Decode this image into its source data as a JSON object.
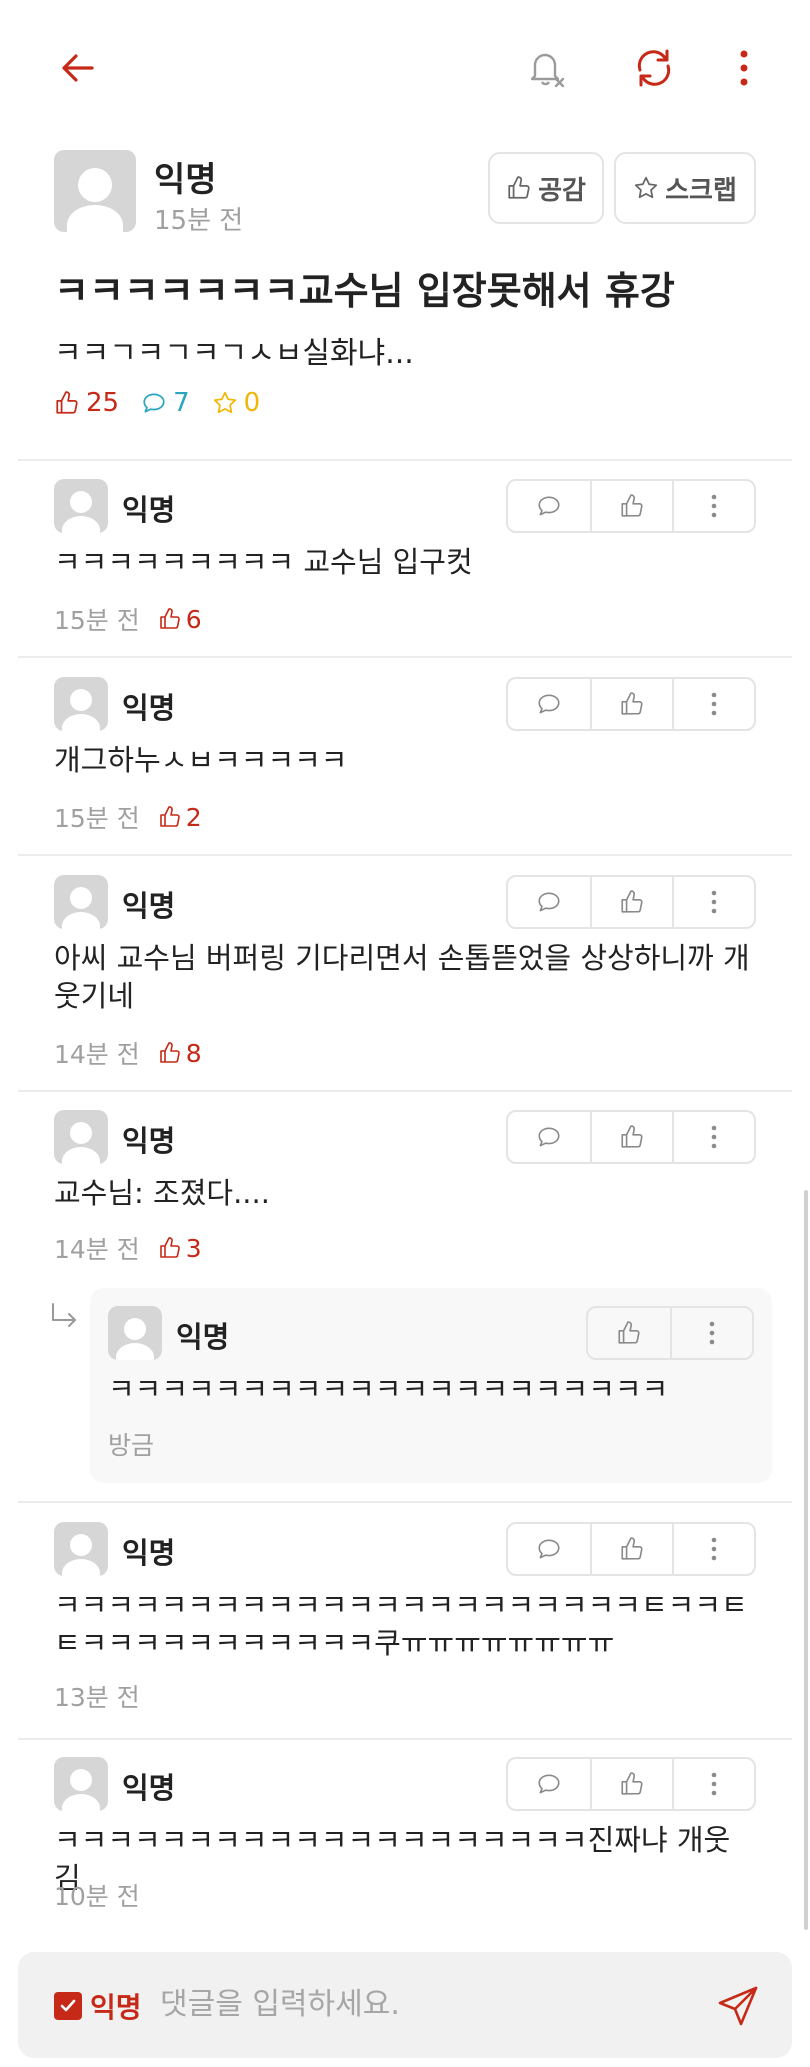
{
  "colors": {
    "accent": "#c62917",
    "comment_count": "#2aa4c0",
    "scrap_count": "#f2b705",
    "muted": "#a0a0a0"
  },
  "topbar": {
    "icons": [
      "back-arrow-icon",
      "notification-off-icon",
      "refresh-icon",
      "more-vertical-icon"
    ]
  },
  "post": {
    "author": "익명",
    "time": "15분 전",
    "buttons": {
      "like": "공감",
      "scrap": "스크랩"
    },
    "title": "ㅋㅋㅋㅋㅋㅋㅋ교수님 입장못해서 휴강",
    "body": "ㅋㅋㄱㅋㄱㅋㄱㅅㅂ실화냐...",
    "stats": {
      "likes": "25",
      "comments": "7",
      "scraps": "0"
    }
  },
  "comments": [
    {
      "author": "익명",
      "text": "ㅋㅋㅋㅋㅋㅋㅋㅋㅋ 교수님 입구컷",
      "time": "15분 전",
      "likes": "6"
    },
    {
      "author": "익명",
      "text": "개그하누ㅅㅂㅋㅋㅋㅋㅋ",
      "time": "15분 전",
      "likes": "2"
    },
    {
      "author": "익명",
      "text": "아씨 교수님 버퍼링 기다리면서 손톱뜯었을 상상하니까 개웃기네",
      "time": "14분 전",
      "likes": "8"
    },
    {
      "author": "익명",
      "text": "교수님: 조졌다....",
      "time": "14분 전",
      "likes": "3"
    },
    {
      "author": "익명",
      "text": "ㅋㅋㅋㅋㅋㅋㅋㅋㅋㅋㅋㅋㅋㅋㅋㅋㅋㅋㅋㅋㅋㅋㅌㅋㅋㅌㅌㅋㅋㅋㅋㅋㅋㅋㅋㅋㅋㅋ쿠ㅠㅠㅠㅠㅠㅠㅠㅠ",
      "time": "13분 전",
      "likes": ""
    },
    {
      "author": "익명",
      "text": "ㅋㅋㅋㅋㅋㅋㅋㅋㅋㅋㅋㅋㅋㅋㅋㅋㅋㅋㅋㅋ진짜냐 개웃김",
      "time": "10분 전",
      "likes": ""
    }
  ],
  "reply": {
    "author": "익명",
    "text": "ㅋㅋㅋㅋㅋㅋㅋㅋㅋㅋㅋㅋㅋㅋㅋㅋㅋㅋㅋㅋㅋ",
    "time": "방금"
  },
  "input": {
    "anonymous_label": "익명",
    "anonymous_checked": true,
    "placeholder": "댓글을 입력하세요."
  }
}
